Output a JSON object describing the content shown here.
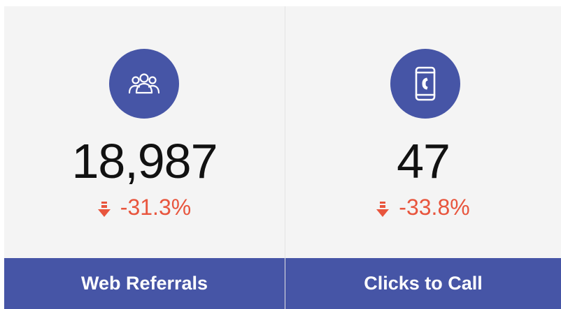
{
  "colors": {
    "accent": "#4655a6",
    "card_bg": "#f4f4f4",
    "negative": "#e8553d",
    "value_text": "#111111"
  },
  "cards": [
    {
      "icon": "users-group-icon",
      "value": "18,987",
      "change": "-31.3%",
      "change_icon": "arrow-down-icon",
      "label": "Web Referrals"
    },
    {
      "icon": "mobile-phone-icon",
      "value": "47",
      "change": "-33.8%",
      "change_icon": "arrow-down-icon",
      "label": "Clicks to Call"
    }
  ]
}
